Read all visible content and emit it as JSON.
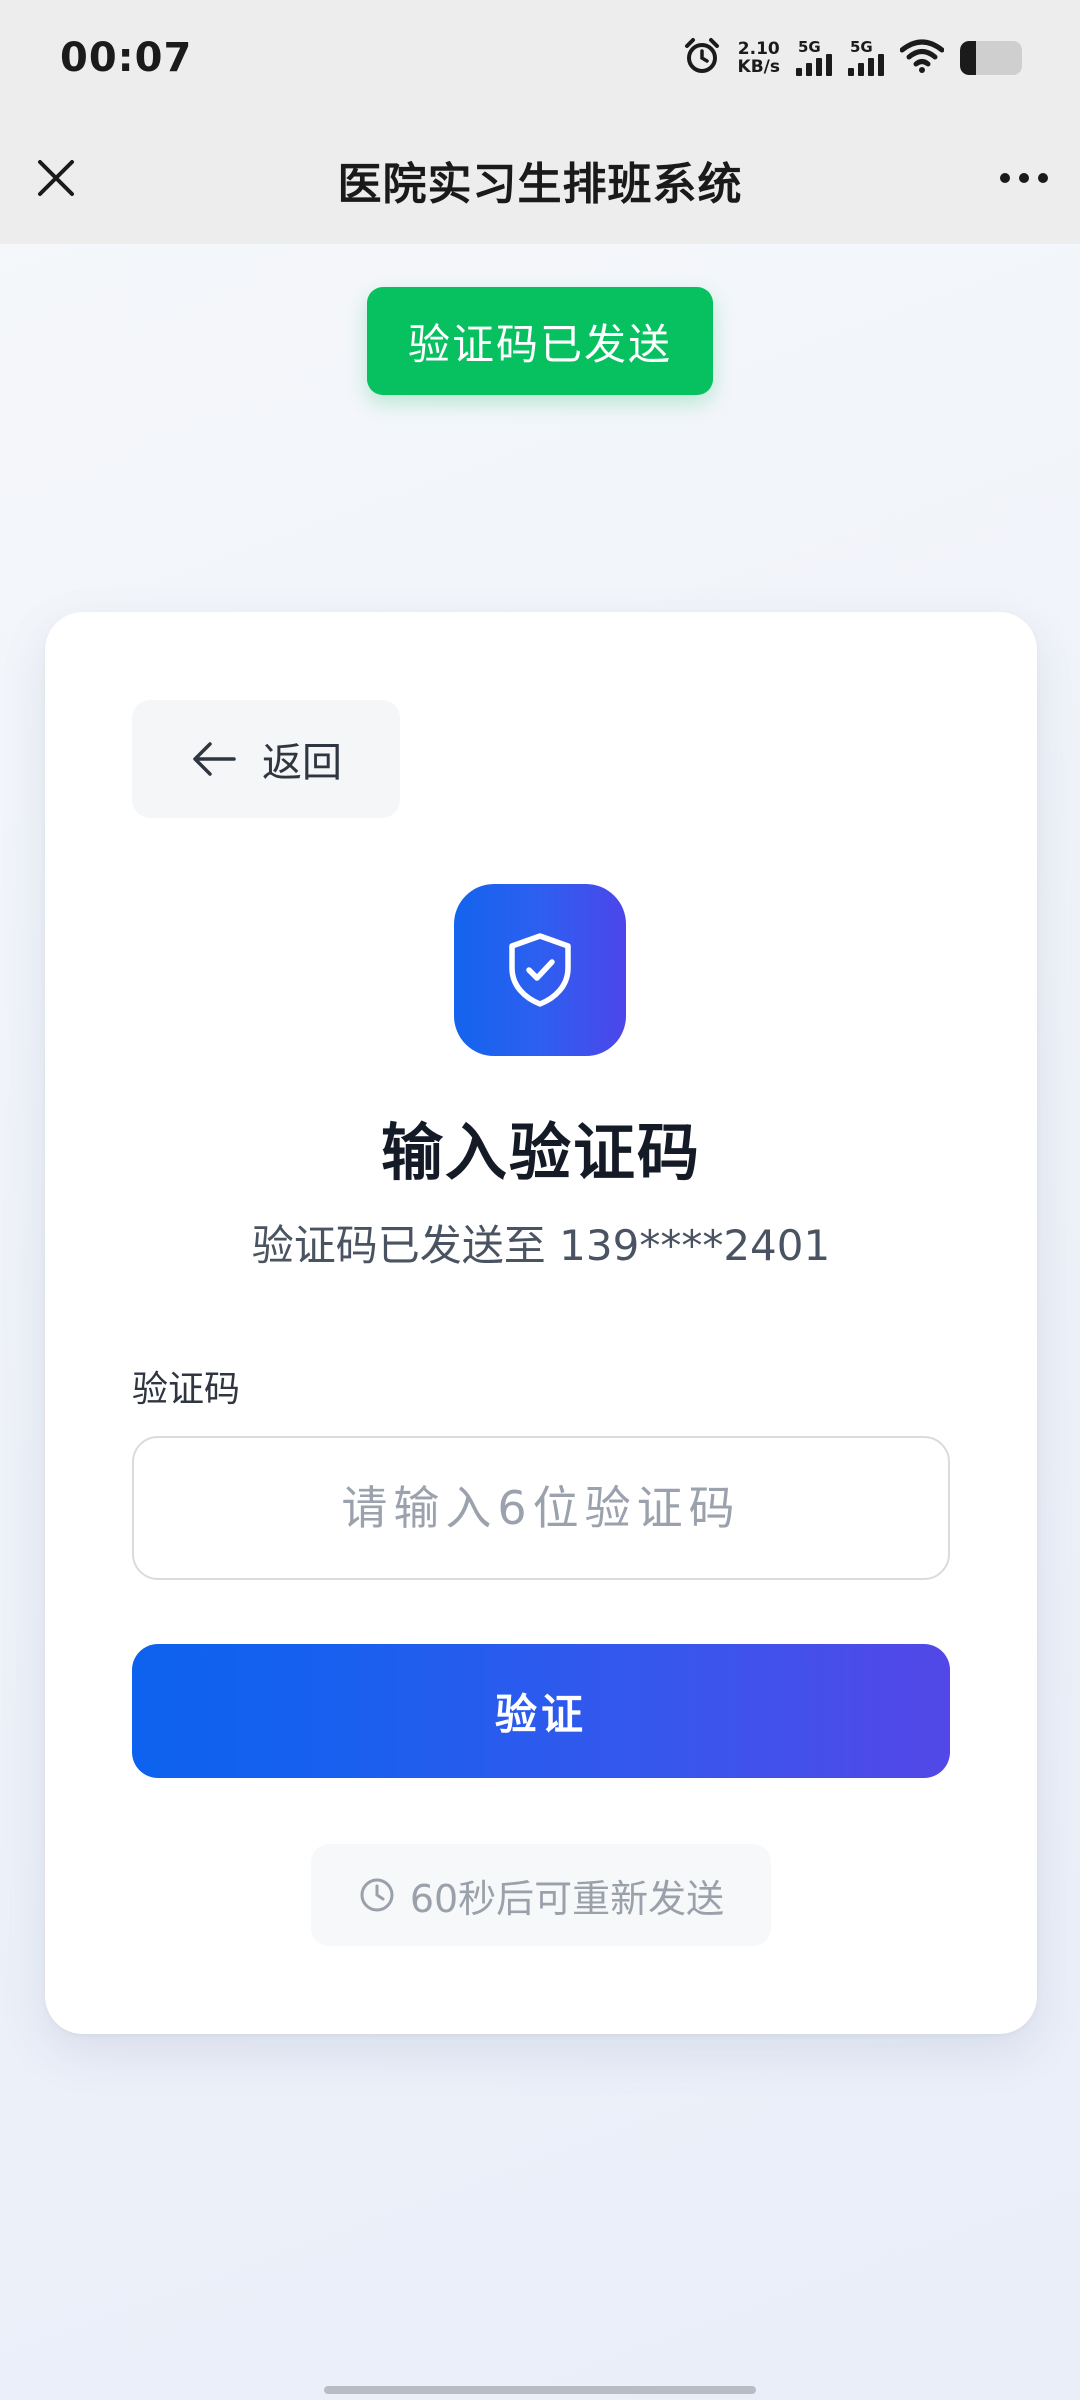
{
  "status_bar": {
    "time": "00:07",
    "net_speed_value": "2.10",
    "net_speed_unit": "KB/s",
    "sim1_label": "5G",
    "sim2_label": "5G",
    "battery_level": 0.25
  },
  "title_bar": {
    "title": "医院实习生排班系统",
    "close_icon": "close-icon",
    "more_icon": "more-icon"
  },
  "toast": {
    "text": "验证码已发送",
    "color": "#07c160"
  },
  "card": {
    "back_label": "返回",
    "heading": "输入验证码",
    "subtitle": "验证码已发送至 139****2401",
    "field_label": "验证码",
    "input_placeholder": "请输入6位验证码",
    "input_value": "",
    "verify_label": "验证",
    "resend_label": "60秒后可重新发送"
  },
  "colors": {
    "accent_start": "#0c62ee",
    "accent_end": "#5347e8"
  }
}
